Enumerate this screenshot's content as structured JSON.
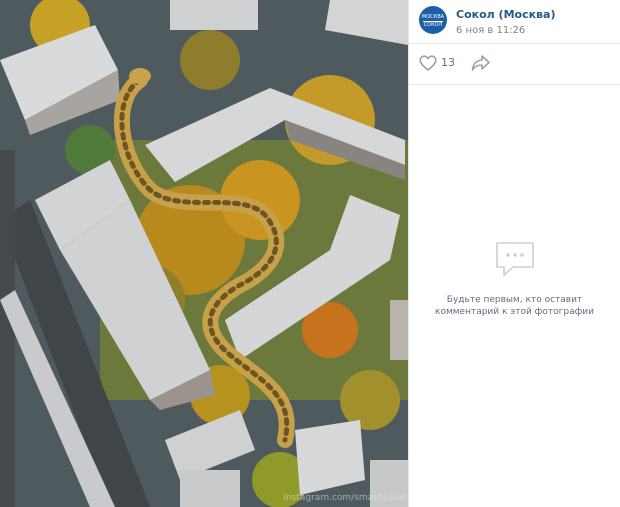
{
  "author": {
    "name": "Сокол (Москва)",
    "avatar_line1": "МОСКВА",
    "avatar_line2": "СОКОЛ"
  },
  "post": {
    "date": "6 ноя в 11:26"
  },
  "actions": {
    "like_count": "13",
    "like_icon": "heart-icon",
    "share_icon": "share-arrow-icon"
  },
  "comments": {
    "empty_line1": "Будьте первым, кто оставит",
    "empty_line2": "комментарий к этой фотографии",
    "empty_icon": "comment-bubble-icon"
  },
  "photo": {
    "watermark": "instagram.com/smashbulat"
  },
  "colors": {
    "link": "#2a5885",
    "meta": "#828282",
    "icon": "#99a2ad",
    "avatar": "#1c5fa8"
  }
}
